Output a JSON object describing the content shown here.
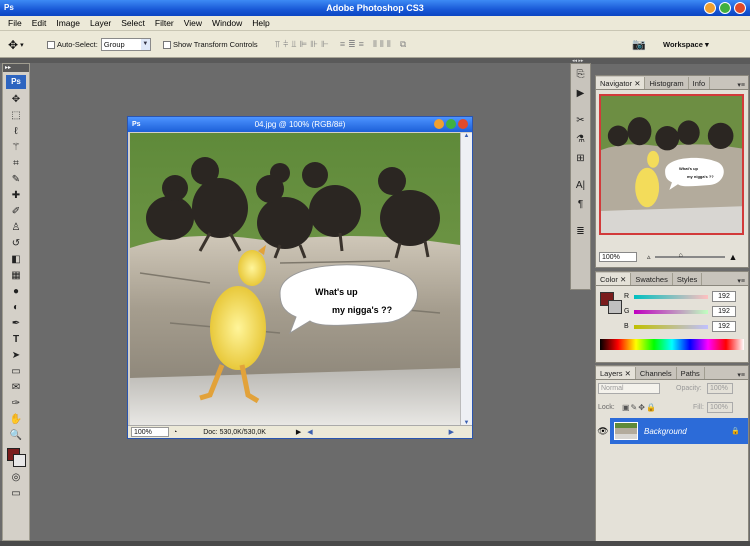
{
  "app": {
    "title": "Adobe Photoshop CS3",
    "logo": "Ps"
  },
  "menu": [
    "File",
    "Edit",
    "Image",
    "Layer",
    "Select",
    "Filter",
    "View",
    "Window",
    "Help"
  ],
  "options": {
    "auto_select_label": "Auto-Select:",
    "auto_select_value": "Group",
    "show_transform_label": "Show Transform Controls",
    "workspace_label": "Workspace ▾"
  },
  "document": {
    "title": "04.jpg @ 100% (RGB/8#)",
    "zoom": "100%",
    "doc_info": "Doc: 530,0K/530,0K",
    "speech_line1": "What's up",
    "speech_line2": "my nigga's ??"
  },
  "navigator": {
    "tabs": [
      "Navigator",
      "Histogram",
      "Info"
    ],
    "zoom": "100%",
    "thumb_line1": "What's up",
    "thumb_line2": "my nigga's ??"
  },
  "color_panel": {
    "tabs": [
      "Color",
      "Swatches",
      "Styles"
    ],
    "r_label": "R",
    "g_label": "G",
    "b_label": "B",
    "r": "192",
    "g": "192",
    "b": "192"
  },
  "layers_panel": {
    "tabs": [
      "Layers",
      "Channels",
      "Paths"
    ],
    "blend_mode": "Normal",
    "opacity_label": "Opacity:",
    "opacity": "100%",
    "lock_label": "Lock:",
    "fill_label": "Fill:",
    "fill": "100%",
    "layer_name": "Background"
  },
  "colors": {
    "accent": "#2c6bd8",
    "foreground": "#7a1c1c",
    "background": "#e8e8e8"
  }
}
